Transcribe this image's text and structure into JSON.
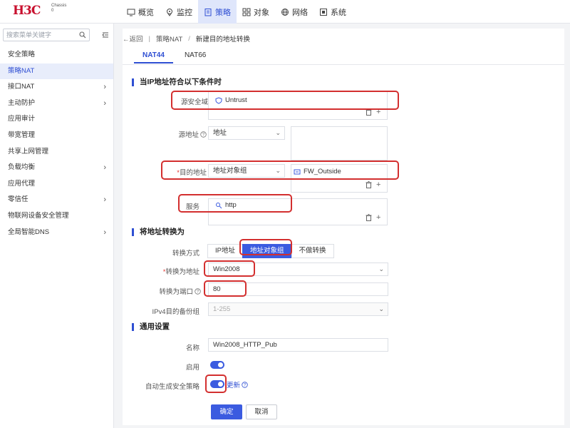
{
  "brand": {
    "logo": "H3C",
    "chassis_line1": "Chassis",
    "chassis_line2": "0",
    "logo_color": "#c8102e"
  },
  "nav": {
    "items": [
      {
        "label": "概览",
        "icon": "dashboard-icon"
      },
      {
        "label": "监控",
        "icon": "location-icon"
      },
      {
        "label": "策略",
        "icon": "policy-icon",
        "active": true
      },
      {
        "label": "对象",
        "icon": "grid-icon"
      },
      {
        "label": "网络",
        "icon": "globe-icon"
      },
      {
        "label": "系统",
        "icon": "system-icon"
      }
    ]
  },
  "sidebar": {
    "search_placeholder": "搜索菜单关键字",
    "items": [
      {
        "label": "安全策略",
        "chevron": false
      },
      {
        "label": "策略NAT",
        "chevron": false,
        "active": true
      },
      {
        "label": "接口NAT",
        "chevron": true
      },
      {
        "label": "主动防护",
        "chevron": true
      },
      {
        "label": "应用审计",
        "chevron": false
      },
      {
        "label": "带宽管理",
        "chevron": false
      },
      {
        "label": "共享上网管理",
        "chevron": false
      },
      {
        "label": "负载均衡",
        "chevron": true
      },
      {
        "label": "应用代理",
        "chevron": false
      },
      {
        "label": "零信任",
        "chevron": true
      },
      {
        "label": "物联网设备安全管理",
        "chevron": false
      },
      {
        "label": "全局智能DNS",
        "chevron": true
      }
    ]
  },
  "breadcrumb": {
    "back": "←返回",
    "parent": "策略NAT",
    "current": "新建目的地址转换"
  },
  "tabs": [
    {
      "label": "NAT44",
      "active": true
    },
    {
      "label": "NAT66",
      "active": false
    }
  ],
  "section_match": {
    "title": "当IP地址符合以下条件时",
    "source_zone": {
      "label": "源安全域",
      "value": "Untrust"
    },
    "source_address": {
      "label": "源地址",
      "type": "地址"
    },
    "dest_address": {
      "label": "目的地址",
      "required_mark": "*",
      "type": "地址对象组",
      "value": "FW_Outside"
    },
    "service": {
      "label": "服务",
      "value": "http"
    }
  },
  "section_translate": {
    "title": "将地址转换为",
    "mode": {
      "label": "转换方式",
      "options": [
        "IP地址",
        "地址对象组",
        "不做转换"
      ],
      "selected": "地址对象组"
    },
    "translate_address": {
      "label": "转换为地址",
      "required_mark": "*",
      "value": "Win2008"
    },
    "translate_port": {
      "label": "转换为端口",
      "value": "80"
    },
    "ipv4_backup": {
      "label": "IPv4目的备份组",
      "placeholder": "1-255"
    }
  },
  "section_general": {
    "title": "通用设置",
    "name": {
      "label": "名称",
      "value": "Win2008_HTTP_Pub"
    },
    "enable": {
      "label": "启用",
      "on": true
    },
    "auto_policy": {
      "label": "自动生成安全策略",
      "on": true,
      "link": "更新"
    }
  },
  "actions": {
    "confirm": "确定",
    "cancel": "取消"
  },
  "colors": {
    "accent": "#3b5be0",
    "highlight": "#d32f2f"
  }
}
